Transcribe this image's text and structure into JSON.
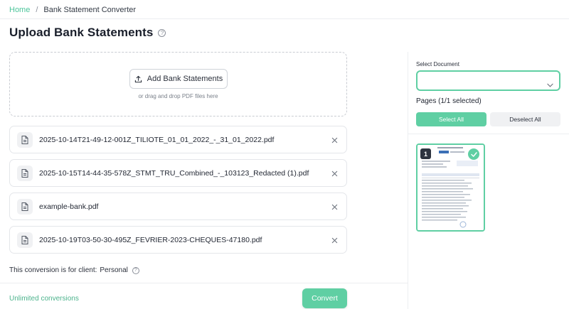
{
  "breadcrumb": {
    "home": "Home",
    "separator": "/",
    "current": "Bank Statement Converter"
  },
  "page": {
    "title": "Upload Bank Statements"
  },
  "upload": {
    "button_label": "Add Bank Statements",
    "hint": "or drag and drop PDF files here"
  },
  "files": [
    {
      "name": "2025-10-14T21-49-12-001Z_TILIOTE_01_01_2022_-_31_01_2022.pdf"
    },
    {
      "name": "2025-10-15T14-44-35-578Z_STMT_TRU_Combined_-_103123_Redacted (1).pdf"
    },
    {
      "name": "example-bank.pdf"
    },
    {
      "name": "2025-10-19T03-50-30-495Z_FEVRIER-2023-CHEQUES-47180.pdf"
    }
  ],
  "client": {
    "label": "This conversion is for client:",
    "value": "Personal"
  },
  "footer": {
    "unlimited": "Unlimited conversions",
    "convert_label": "Convert"
  },
  "document_panel": {
    "select_label": "Select Document",
    "selected_value": "",
    "pages_label": "Pages (1/1 selected)",
    "select_all": "Select All",
    "deselect_all": "Deselect All",
    "pages": [
      {
        "number": "1",
        "selected": true
      }
    ]
  },
  "colors": {
    "accent": "#5fcfa3",
    "link": "#4cc59b",
    "text": "#1f2430"
  }
}
